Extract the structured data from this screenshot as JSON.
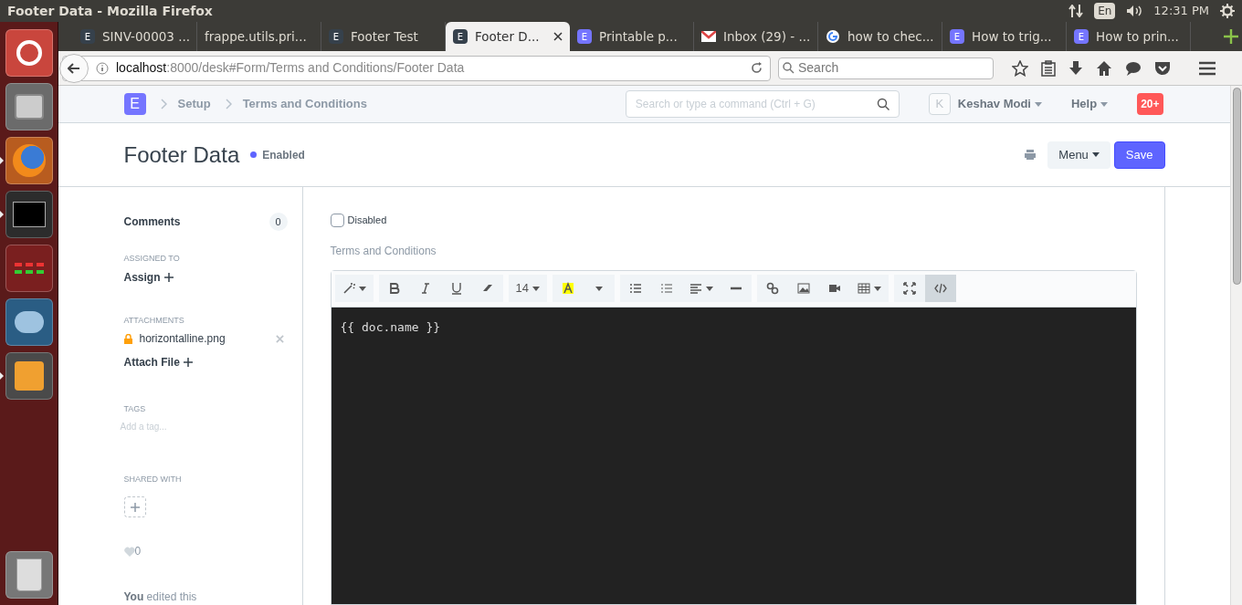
{
  "system_bar": {
    "title": "Footer Data - Mozilla Firefox",
    "keyboard": "En",
    "time": "12:31 PM"
  },
  "launcher": [
    {
      "kind": "dash",
      "running": false
    },
    {
      "kind": "files",
      "running": false
    },
    {
      "kind": "firefox",
      "running": true
    },
    {
      "kind": "terminal",
      "running": true
    },
    {
      "kind": "calculator",
      "running": false
    },
    {
      "kind": "database",
      "running": false
    },
    {
      "kind": "editor",
      "running": true
    },
    {
      "kind": "trash",
      "running": false
    }
  ],
  "tabs": [
    {
      "label": "SINV-00003 ...",
      "kind": "erp",
      "icon_text": "E",
      "selected": false
    },
    {
      "label": "frappe.utils.pri...",
      "kind": "plain",
      "selected": false
    },
    {
      "label": "Footer Test",
      "kind": "erp",
      "icon_text": "E",
      "selected": false
    },
    {
      "label": "Footer D...",
      "kind": "erp",
      "icon_text": "E",
      "selected": true
    },
    {
      "label": "Printable p...",
      "kind": "erp-blue",
      "icon_text": "E",
      "selected": false
    },
    {
      "label": "Inbox (29) - ...",
      "kind": "mail",
      "selected": false
    },
    {
      "label": "how to chec...",
      "kind": "google",
      "selected": false
    },
    {
      "label": "How to trig...",
      "kind": "erp-blue",
      "icon_text": "E",
      "selected": false
    },
    {
      "label": "How to prin...",
      "kind": "erp-blue",
      "icon_text": "E",
      "selected": false
    }
  ],
  "address_bar": {
    "host": "localhost",
    "path": ":8000/desk#Form/Terms and Conditions/Footer Data"
  },
  "browser_search": {
    "placeholder": "Search"
  },
  "navbar": {
    "logo": "E",
    "breadcrumbs": [
      "Setup",
      "Terms and Conditions"
    ],
    "search": {
      "placeholder": "Search or type a command (Ctrl + G)"
    },
    "avatar": "K",
    "user": "Keshav Modi",
    "help": "Help",
    "notifications": "20+"
  },
  "page_head": {
    "title": "Footer Data",
    "status": "Enabled",
    "menu": "Menu",
    "save": "Save"
  },
  "sidebar": {
    "comments": {
      "label": "Comments",
      "count": "0"
    },
    "assigned": {
      "heading": "ASSIGNED TO",
      "action": "Assign"
    },
    "attachments": {
      "heading": "ATTACHMENTS",
      "files": [
        "horizontalline.png"
      ],
      "action": "Attach File"
    },
    "tags": {
      "heading": "TAGS",
      "placeholder": "Add a tag..."
    },
    "shared": {
      "heading": "SHARED WITH"
    },
    "likes": "0",
    "activity": "**You** edited this"
  },
  "form": {
    "disabled": {
      "label": "Disabled",
      "checked": false
    },
    "field_label": "Terms and Conditions",
    "toolbar": [
      [
        {
          "kind": "magic",
          "selected": false
        }
      ],
      [
        {
          "kind": "bold",
          "selected": false
        },
        {
          "kind": "italic",
          "selected": false
        },
        {
          "kind": "underline",
          "selected": false
        },
        {
          "kind": "eraser",
          "selected": false
        }
      ],
      [
        {
          "kind": "size",
          "text": "14",
          "selected": false
        }
      ],
      [
        {
          "kind": "color",
          "selected": false
        },
        {
          "kind": "caret",
          "selected": false
        }
      ],
      [
        {
          "kind": "ul",
          "selected": false
        },
        {
          "kind": "ol",
          "selected": false
        },
        {
          "kind": "align",
          "selected": false
        },
        {
          "kind": "hr",
          "selected": false
        }
      ],
      [
        {
          "kind": "link",
          "selected": false
        },
        {
          "kind": "picture",
          "selected": false
        },
        {
          "kind": "video",
          "selected": false
        },
        {
          "kind": "table",
          "selected": false
        }
      ],
      [
        {
          "kind": "fullscreen",
          "selected": false
        },
        {
          "kind": "code",
          "selected": true
        }
      ]
    ],
    "code": "{{ doc.name }}"
  }
}
